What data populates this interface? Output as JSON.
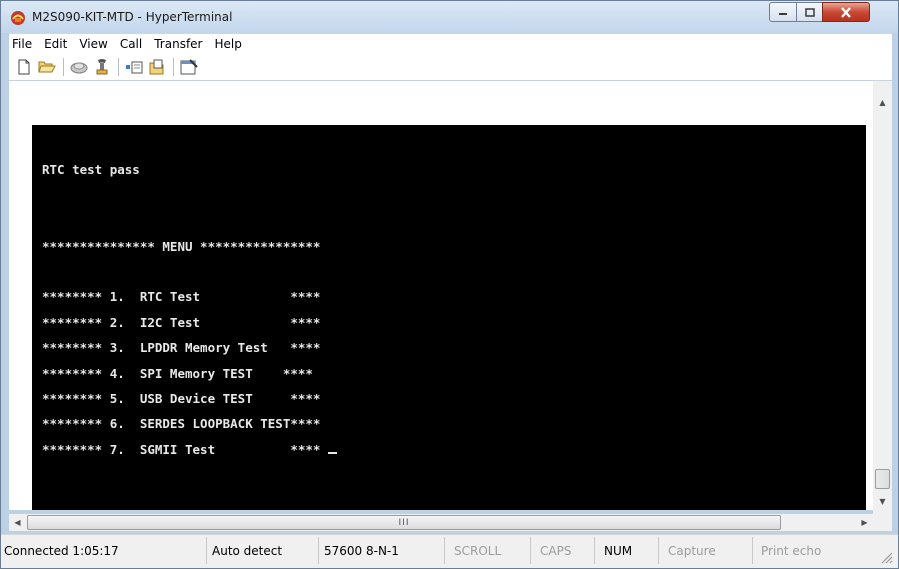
{
  "window": {
    "title": "M2S090-KIT-MTD - HyperTerminal",
    "icon": "hyperterminal-icon"
  },
  "menu": [
    "File",
    "Edit",
    "View",
    "Call",
    "Transfer",
    "Help"
  ],
  "toolbar": {
    "icons": [
      "new-icon",
      "open-icon",
      "disconnect-icon",
      "call-icon",
      "send-icon",
      "receive-icon",
      "properties-icon"
    ]
  },
  "terminal": {
    "lines": [
      "",
      "RTC test pass",
      "",
      "",
      "*************** MENU ****************",
      "",
      "******** 1.  RTC Test            ****",
      "******** 2.  I2C Test            ****",
      "******** 3.  LPDDR Memory Test   ****",
      "******** 4.  SPI Memory TEST    ****",
      "******** 5.  USB Device TEST     ****",
      "******** 6.  SERDES LOOPBACK TEST****",
      "******** 7.  SGMII Test          **** "
    ]
  },
  "hscroll": {
    "thumb_grip": "III"
  },
  "status": {
    "connected": "Connected 1:05:17",
    "detect": "Auto detect",
    "settings": "57600 8-N-1",
    "scroll": "SCROLL",
    "caps": "CAPS",
    "num": "NUM",
    "capture": "Capture",
    "print_echo": "Print echo"
  }
}
